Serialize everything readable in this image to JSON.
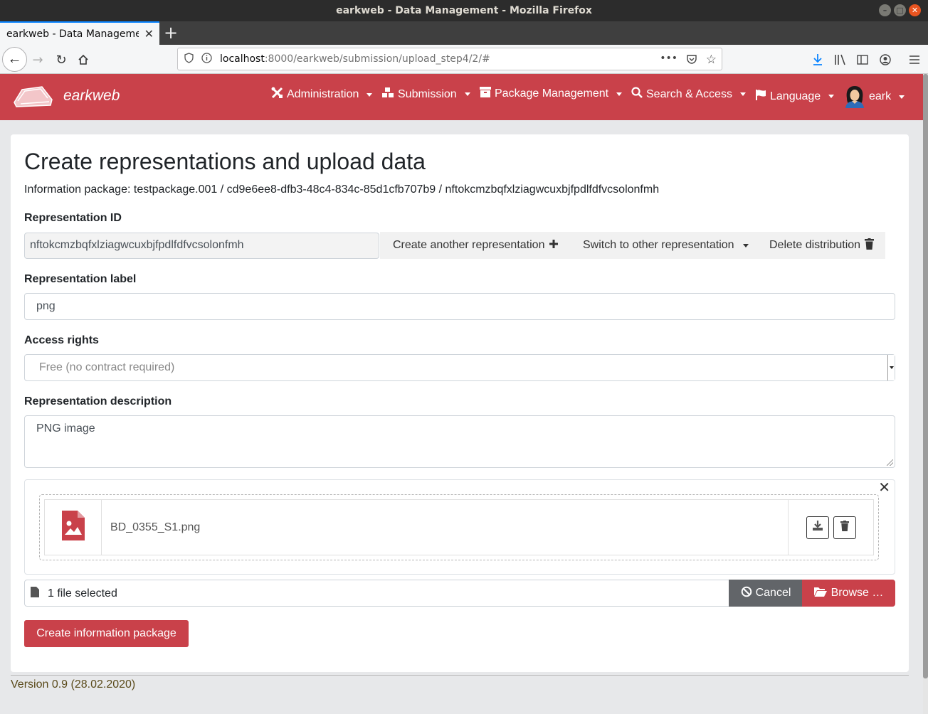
{
  "browser": {
    "window_title": "earkweb - Data Management - Mozilla Firefox",
    "tab_title": "earkweb - Data Management - Mozilla Firefox",
    "url_host": "localhost",
    "url_rest": ":8000/earkweb/submission/upload_step4/2/#",
    "url_overflow": "•••"
  },
  "app": {
    "brand": "earkweb",
    "menu": {
      "administration": "Administration",
      "submission": "Submission",
      "package_management": "Package Management",
      "search_access": "Search & Access",
      "language": "Language",
      "user": "eark"
    },
    "accent_color": "#c9414a"
  },
  "page": {
    "title": "Create representations and upload data",
    "package_info": "Information package: testpackage.001 / cd9e6ee8-dfb3-48c4-834c-85d1cfb707b9 / nftokcmzbqfxlziagwcuxbjfpdlfdfvcsolonfmh"
  },
  "form": {
    "rep_id_label": "Representation ID",
    "rep_id_value": "nftokcmzbqfxlziagwcuxbjfpdlfdfvcsolonfmh",
    "create_another": "Create another representation",
    "switch_other": "Switch to other representation",
    "delete_distribution": "Delete distribution",
    "rep_label_label": "Representation label",
    "rep_label_value": "png",
    "access_rights_label": "Access rights",
    "access_rights_value": "Free (no contract required)",
    "rep_desc_label": "Representation description",
    "rep_desc_value": "PNG image"
  },
  "upload": {
    "file_name": "BD_0355_S1.png",
    "files_selected": "1 file selected",
    "cancel": "Cancel",
    "browse": "Browse …",
    "create_package": "Create information package"
  },
  "footer": {
    "version": "Version 0.9 (28.02.2020)"
  }
}
